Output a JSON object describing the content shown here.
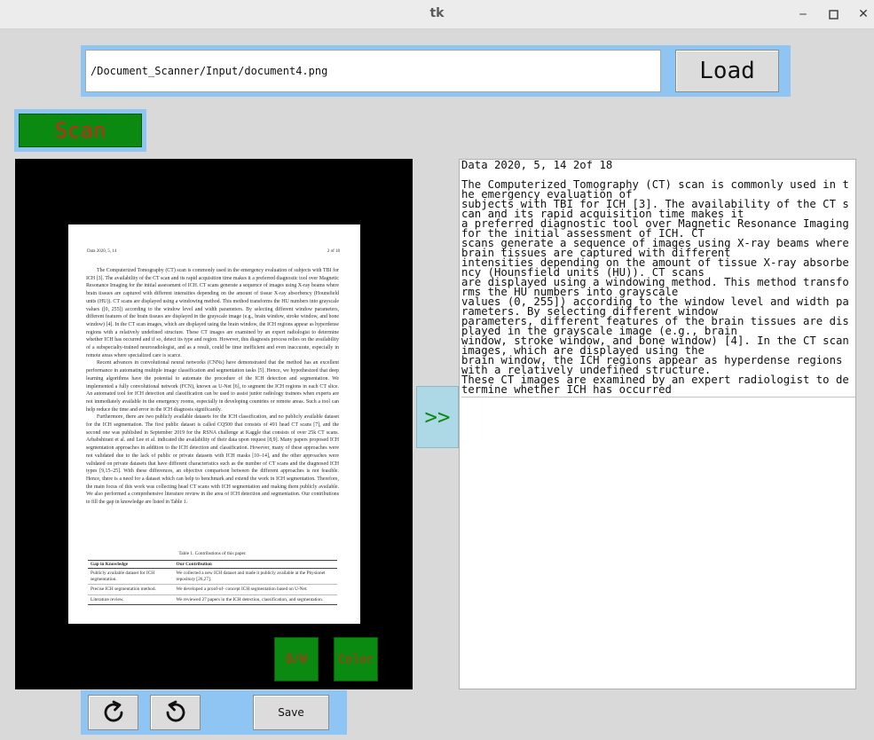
{
  "window": {
    "title": "tk",
    "minimize_glyph": "‒",
    "maximize_glyph": "☐",
    "close_glyph": "✕"
  },
  "path_input": {
    "value": "/Document_Scanner/Input/document4.png"
  },
  "buttons": {
    "load": "Load",
    "scan": "Scan",
    "bw": "B/W",
    "color": "Color",
    "save": "Save",
    "transfer": ">>"
  },
  "icons": {
    "rotate_right": "rotate-clockwise-icon",
    "rotate_left": "rotate-counterclockwise-icon"
  },
  "colors": {
    "frame": "#8fc5f2",
    "green_button": "#0a8a10",
    "red_text": "#c8281c",
    "arrow_bg": "#add8e6"
  },
  "document": {
    "header_left": "Data 2020, 5, 14",
    "header_right": "2 of 18",
    "paragraphs": [
      "The Computerized Tomography (CT) scan is commonly used in the emergency evaluation of subjects with TBI for ICH [3]. The availability of the CT scan and its rapid acquisition time makes it a preferred diagnostic tool over Magnetic Resonance Imaging for the initial assessment of ICH. CT scans generate a sequence of images using X-ray beams where brain tissues are captured with different intensities depending on the amount of tissue X-ray absorbency (Hounsfield units (HU)). CT scans are displayed using a windowing method. This method transforms the HU numbers into grayscale values ([0, 255]) according to the window level and width parameters. By selecting different window parameters, different features of the brain tissues are displayed in the grayscale image (e.g., brain window, stroke window, and bone window) [4]. In the CT scan images, which are displayed using the brain window, the ICH regions appear as hyperdense regions with a relatively undefined structure. These CT images are examined by an expert radiologist to determine whether ICH has occurred and if so, detect its type and region. However, this diagnosis process relies on the availability of a subspecialty-trained neuroradiologist, and as a result, could be time inefficient and even inaccurate, especially in remote areas where specialized care is scarce.",
      "Recent advances in convolutional neural networks (CNNs) have demonstrated that the method has an excellent performance in automating multiple image classification and segmentation tasks [5]. Hence, we hypothesized that deep learning algorithms have the potential to automate the procedure of the ICH detection and segmentation. We implemented a fully convolutional network (FCN), known as U-Net [6], to segment the ICH regions in each CT slice. An automated tool for ICH detection and classification can be used to assist junior radiology trainees when experts are not immediately available in the emergency rooms, especially in developing countries or remote areas. Such a tool can help reduce the time and error in the ICH diagnosis significantly.",
      "Furthermore, there are two publicly available datasets for the ICH classification, and no publicly available dataset for the ICH segmentation. The first public dataset is called CQ500 that consists of 491 head CT scans [7], and the second one was published in September 2019 for the RSNA challenge at Kaggle that consists of over 25k CT scans. Arbabshirani et al. and Lee et al. indicated the availability of their data upon request [8,9]. Many papers proposed ICH segmentation approaches in addition to the ICH detection and classification. However, many of these approaches were not validated due to the lack of public or private datasets with ICH masks [10–14], and the other approaches were validated on private datasets that have different characteristics such as the number of CT scans and the diagnosed ICH types [9,15–25]. With these differences, an objective comparison between the different approaches is not feasible. Hence, there is a need for a dataset which can help to benchmark and extend the work in ICH segmentation. Therefore, the main focus of this work was collecting head CT scans with ICH segmentation and making them publicly available. We also performed a comprehensive literature review in the area of ICH detection and segmentation. Our contributions to fill the gap in knowledge are listed in Table 1."
    ],
    "table_caption": "Table 1. Contributions of this paper.",
    "table_headers": [
      "Gap in Knowledge",
      "Our Contribution"
    ],
    "table_rows": [
      [
        "Publicly available dataset for ICH segmentation.",
        "We collected a new ICH dataset and made it publicly available at the Physionet repository [26,27]."
      ],
      [
        "Precise ICH segmentation method.",
        "We developed a proof-of- concept ICH segmentation based on U-Net."
      ],
      [
        "Literature review.",
        "We reviewed 27 papers in the ICH detection, classification, and segmentation."
      ]
    ]
  },
  "ocr_text": "Data 2020, 5, 14 2of 18\n\nThe Computerized Tomography (CT) scan is commonly used in the emergency evaluation of\nsubjects with TBI for ICH [3]. The availability of the CT scan and its rapid acquisition time makes it\na preferred diagnostic tool over Magnetic Resonance Imaging for the initial assessment of ICH. CT\nscans generate a sequence of images using X-ray beams where brain tissues are captured with different\nintensities depending on the amount of tissue X-ray absorbency (Hounsfield units (HU)). CT scans\nare displayed using a windowing method. This method transforms the HU numbers into grayscale\nvalues (0, 255]) according to the window level and width parameters. By selecting different window\nparameters, different features of the brain tissues are displayed in the grayscale image (e.g., brain\nwindow, stroke window, and bone window) [4]. In the CT scan images, which are displayed using the\nbrain window, the ICH regions appear as hyperdense regions with a relatively undefined structure.\nThese CT images are examined by an expert radiologist to determine whether ICH has occurred"
}
